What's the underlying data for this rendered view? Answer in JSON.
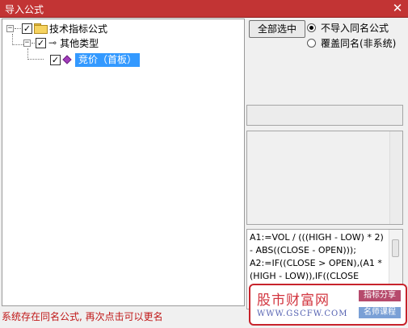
{
  "window": {
    "title": "导入公式",
    "close_glyph": "✕"
  },
  "tree": {
    "nodes": [
      {
        "label": "技术指标公式",
        "expander": "−",
        "checked": true
      },
      {
        "label": "其他类型",
        "expander": "−",
        "checked": true
      },
      {
        "label": "竞价（首板）",
        "checked": true,
        "selected": true
      }
    ],
    "check_glyph": "✓"
  },
  "options": {
    "select_all_label": "全部选中",
    "radio_skip_label": "不导入同名公式",
    "radio_overwrite_label": "覆盖同名(非系统)",
    "selected_radio": "skip"
  },
  "code": {
    "text": "A1:=VOL / (((HIGH - LOW) * 2) - ABS((CLOSE - OPEN)));\nA2:=IF((CLOSE > OPEN),(A1 * (HIGH - LOW)),IF((CLOSE"
  },
  "status": {
    "message": "系统存在同名公式, 再次点击可以更名"
  },
  "watermark": {
    "logo": "股市财富网",
    "url": "WWW.GSCFW.COM",
    "badge1": "指标分享",
    "badge2": "名师课程"
  },
  "colors": {
    "titlebar": "#c23434",
    "selection": "#3399ff",
    "status_text": "#c01818",
    "watermark_border": "#c7232c"
  }
}
